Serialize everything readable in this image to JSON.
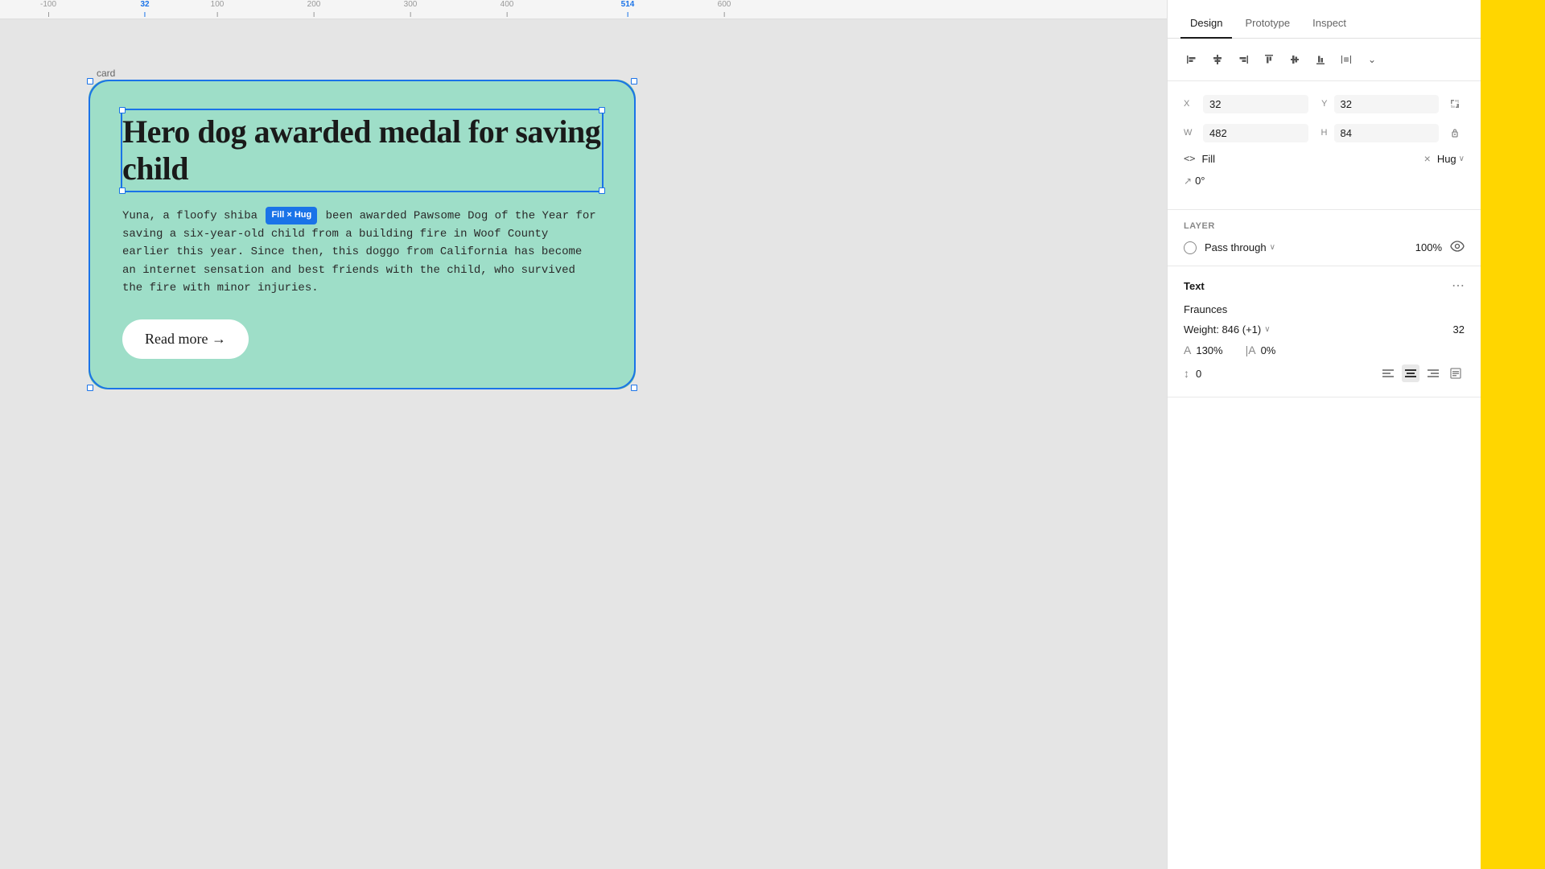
{
  "ruler": {
    "ticks": [
      "-100",
      "32",
      "100",
      "200",
      "300",
      "400",
      "514",
      "600"
    ]
  },
  "canvas": {
    "frame_label": "card",
    "card": {
      "title": "Hero dog awarded medal for saving child",
      "body_text": "Yuna, a floofy shiba ",
      "body_badge": "Fill × Hug",
      "body_rest": " been awarded Pawsome Dog of the Year for saving a six-year-old child from a building fire in Woof County earlier this year. Since then, this doggo from California has become an internet sensation and best friends with the child, who survived the fire with minor injuries.",
      "btn_label": "Read more →"
    }
  },
  "panel": {
    "tabs": [
      "Design",
      "Prototype",
      "Inspect"
    ],
    "active_tab": "Design",
    "position": {
      "x_label": "X",
      "x_value": "32",
      "y_label": "Y",
      "y_value": "32",
      "w_label": "W",
      "w_value": "482",
      "h_label": "H",
      "h_value": "84"
    },
    "fill": {
      "icon": "<>",
      "label": "Fill",
      "x": "×",
      "hug": "Hug"
    },
    "angle": "0°",
    "layer": {
      "title": "Layer",
      "blend": "Pass through",
      "opacity": "100%"
    },
    "text": {
      "title": "Text",
      "font_name": "Fraunces",
      "weight_label": "Weight: 846 (+1)",
      "font_size": "32",
      "line_height_icon": "A↕",
      "line_height": "130%",
      "letter_spacing_icon": "A|",
      "letter_spacing": "0%",
      "paragraph_spacing": "0",
      "align_left": "≡",
      "align_center": "≡",
      "align_right": "≡",
      "frame_icon": "⊡"
    }
  }
}
